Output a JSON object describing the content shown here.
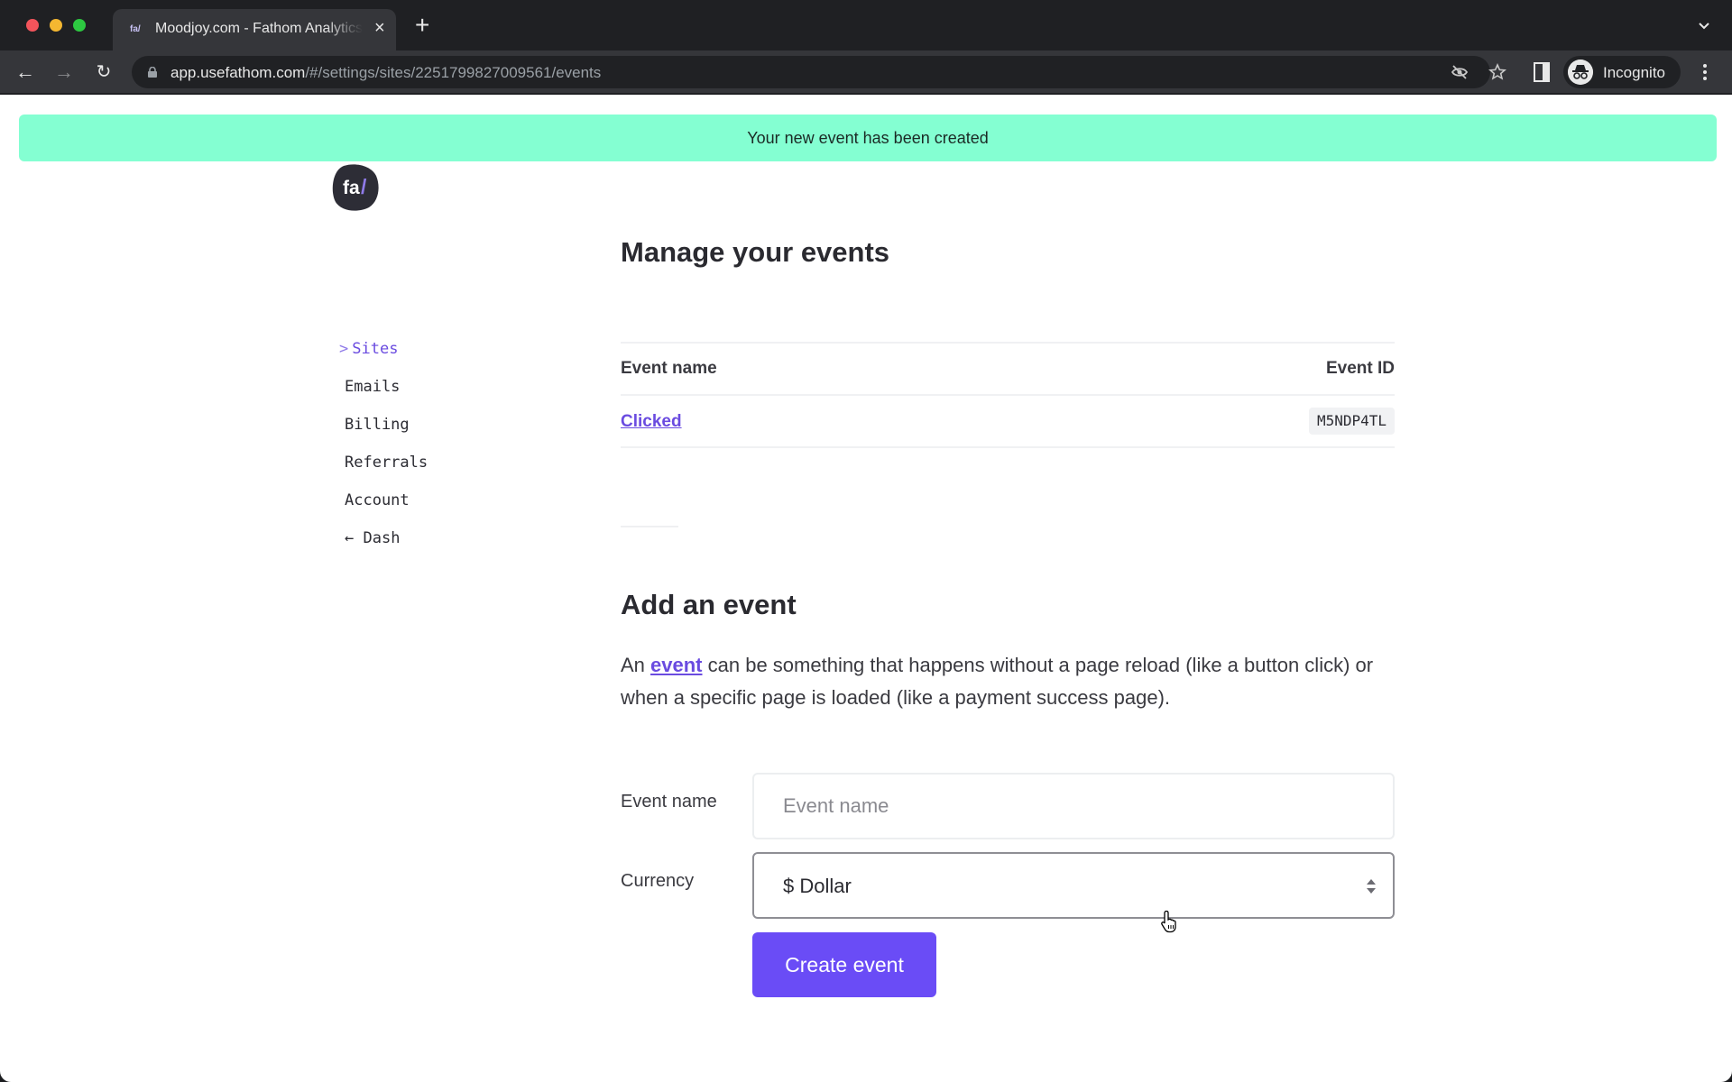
{
  "browser": {
    "tab": {
      "favicon": "fa/",
      "title": "Moodjoy.com - Fathom Analytics"
    },
    "address": {
      "host": "app.usefathom.com",
      "path": "/#/settings/sites/2251799827009561/events"
    },
    "profile_label": "Incognito",
    "icons": [
      "back-arrow-icon",
      "forward-arrow-icon",
      "reload-icon",
      "lock-icon",
      "eye-off-icon",
      "star-icon",
      "side-panel-icon",
      "incognito-icon",
      "menu-dots-icon",
      "tab-search-chevron-icon"
    ]
  },
  "flash": {
    "message": "Your new event has been created",
    "color": "#84ffd2"
  },
  "logo": {
    "text_main": "fa",
    "text_accent": "/"
  },
  "sidebar": {
    "items": [
      {
        "label": "Sites",
        "prefix": ">",
        "active": true
      },
      {
        "label": "Emails",
        "active": false
      },
      {
        "label": "Billing",
        "active": false
      },
      {
        "label": "Referrals",
        "active": false
      },
      {
        "label": "Account",
        "active": false
      },
      {
        "label": "Dash",
        "prefix": "←",
        "active": false
      }
    ]
  },
  "manage": {
    "title": "Manage your events",
    "columns": [
      "Event name",
      "Event ID"
    ],
    "rows": [
      {
        "name": "Clicked",
        "id": "M5NDP4TL"
      }
    ]
  },
  "add": {
    "title": "Add an event",
    "description_before": "An ",
    "description_link": "event",
    "description_after": " can be something that happens without a page reload (like a button click) or when a specific page is loaded (like a payment success page).",
    "event_name_label": "Event name",
    "event_name_value": "",
    "event_name_placeholder": "Event name",
    "currency_label": "Currency",
    "currency_value": "$ Dollar",
    "submit_label": "Create event"
  },
  "colors": {
    "accent": "#6a4be0",
    "button": "#6a4cf6",
    "text": "#2a2a30"
  }
}
